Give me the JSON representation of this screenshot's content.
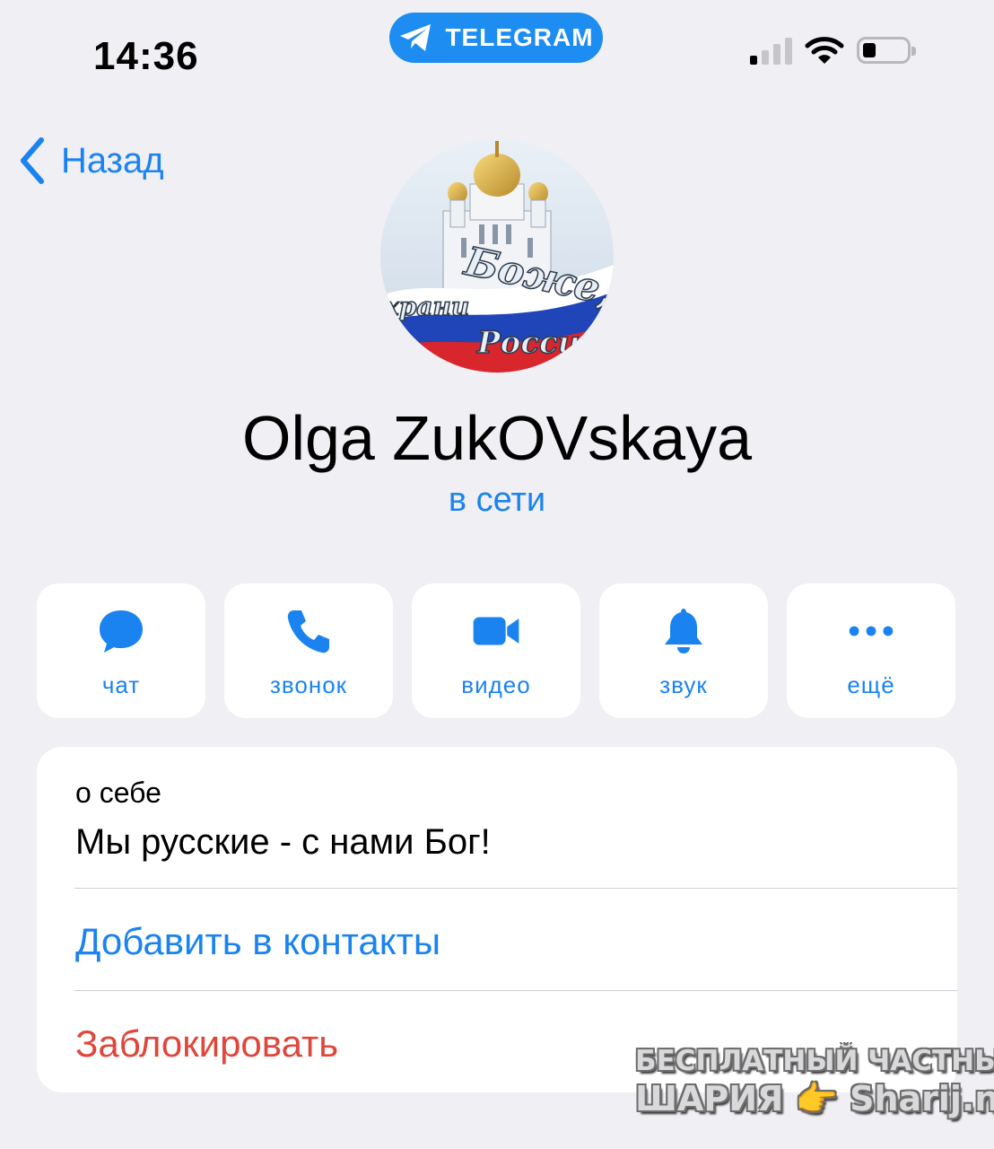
{
  "status_bar": {
    "time": "14:36",
    "app_pill": "TELEGRAM",
    "signal_bars_active": 1,
    "signal_bars_total": 4,
    "battery_level_fraction": 0.25
  },
  "nav": {
    "back_label": "Назад"
  },
  "profile": {
    "name": "Olga ZukOVskaya",
    "status": "в сети"
  },
  "avatar_text": {
    "line1": "Боже,",
    "line2": "храни",
    "line3": "Россию"
  },
  "actions": [
    {
      "label": "чат",
      "icon": "chat-bubble-icon"
    },
    {
      "label": "звонок",
      "icon": "phone-icon"
    },
    {
      "label": "видео",
      "icon": "video-camera-icon"
    },
    {
      "label": "звук",
      "icon": "bell-icon"
    },
    {
      "label": "ещё",
      "icon": "more-dots-icon"
    }
  ],
  "info": {
    "about_label": "о себе",
    "about_text": "Мы русские - с нами Бог!",
    "add_contact": "Добавить в контакты",
    "block": "Заблокировать"
  },
  "watermark": {
    "line1": "БЕСПЛАТНЫЙ ЧАСТНЫЙ",
    "line2_left": "ШАРИЯ",
    "line2_right": "Sharij.net"
  },
  "colors": {
    "accent": "#1a83f0",
    "destructive": "#e0463a",
    "background": "#efeff4"
  }
}
